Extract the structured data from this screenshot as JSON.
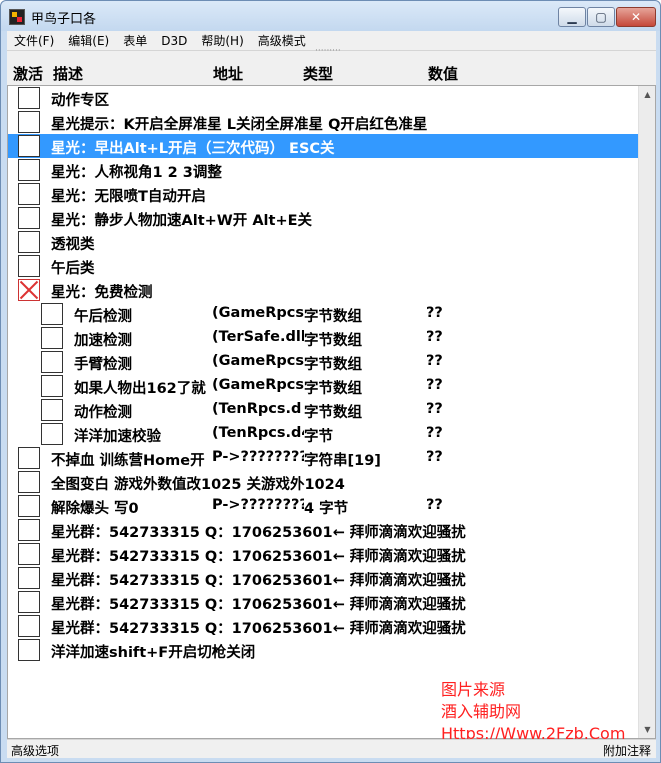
{
  "window": {
    "title": "甲鸟子口各",
    "controls": {
      "minimize": "▁",
      "maximize": "▢",
      "close": "✕"
    }
  },
  "menu": [
    "文件(F)",
    "编辑(E)",
    "表单",
    "D3D",
    "帮助(H)",
    "高级模式"
  ],
  "columns": {
    "activate": "激活",
    "description": "描述",
    "address": "地址",
    "type": "类型",
    "value": "数值"
  },
  "rows": [
    {
      "desc": "动作专区",
      "addr": "",
      "type": "",
      "value": "",
      "checked": false,
      "indent": 0
    },
    {
      "desc": "星光提示：K开启全屏准星 L关闭全屏准星 Q开启红色准星",
      "addr": "",
      "type": "",
      "value": "",
      "checked": false,
      "indent": 0
    },
    {
      "desc": "星光：早出Alt+L开启（三次代码） ESC关",
      "addr": "",
      "type": "",
      "value": "",
      "checked": false,
      "indent": 0,
      "selected": true
    },
    {
      "desc": "星光：人称视角1 2 3调整",
      "addr": "",
      "type": "",
      "value": "",
      "checked": false,
      "indent": 0
    },
    {
      "desc": "星光：无限喷T自动开启",
      "addr": "",
      "type": "",
      "value": "",
      "checked": false,
      "indent": 0
    },
    {
      "desc": "星光：静步人物加速Alt+W开 Alt+E关",
      "addr": "",
      "type": "",
      "value": "",
      "checked": false,
      "indent": 0
    },
    {
      "desc": "透视类",
      "addr": "",
      "type": "",
      "value": "",
      "checked": false,
      "indent": 0
    },
    {
      "desc": "午后类",
      "addr": "",
      "type": "",
      "value": "",
      "checked": false,
      "indent": 0
    },
    {
      "desc": "星光：免费检测",
      "addr": "",
      "type": "",
      "value": "",
      "checked": true,
      "indent": 0
    },
    {
      "desc": "午后检测",
      "addr": "(GameRpcs",
      "type": "字节数组",
      "value": "??",
      "checked": false,
      "indent": 1
    },
    {
      "desc": "加速检测",
      "addr": "(TerSafe.dll",
      "type": "字节数组",
      "value": "??",
      "checked": false,
      "indent": 1
    },
    {
      "desc": "手臂检测",
      "addr": "(GameRpcs",
      "type": "字节数组",
      "value": "??",
      "checked": false,
      "indent": 1
    },
    {
      "desc": "如果人物出162了就",
      "addr": "(GameRpcs",
      "type": "字节数组",
      "value": "??",
      "checked": false,
      "indent": 1
    },
    {
      "desc": "动作检测",
      "addr": "(TenRpcs.d",
      "type": "字节数组",
      "value": "??",
      "checked": false,
      "indent": 1
    },
    {
      "desc": "洋洋加速校验",
      "addr": "(TenRpcs.d4",
      "type": "字节",
      "value": "??",
      "checked": false,
      "indent": 1
    },
    {
      "desc": "不掉血 训练营Home开",
      "addr": "P->????????",
      "type": "字符串[19]",
      "value": "??",
      "checked": false,
      "indent": 0
    },
    {
      "desc": "全图变白 游戏外数值改1025 关游戏外1024",
      "addr": "",
      "type": "",
      "value": "",
      "checked": false,
      "indent": 0
    },
    {
      "desc": "解除爆头 写0",
      "addr": "P->????????",
      "type": "4 字节",
      "value": "??",
      "checked": false,
      "indent": 0
    },
    {
      "desc": "星光群：542733315  Q：1706253601← 拜师滴滴欢迎骚扰",
      "addr": "",
      "type": "",
      "value": "",
      "checked": false,
      "indent": 0
    },
    {
      "desc": "星光群：542733315  Q：1706253601← 拜师滴滴欢迎骚扰",
      "addr": "",
      "type": "",
      "value": "",
      "checked": false,
      "indent": 0
    },
    {
      "desc": "星光群：542733315  Q：1706253601← 拜师滴滴欢迎骚扰",
      "addr": "",
      "type": "",
      "value": "",
      "checked": false,
      "indent": 0
    },
    {
      "desc": "星光群：542733315  Q：1706253601← 拜师滴滴欢迎骚扰",
      "addr": "",
      "type": "",
      "value": "",
      "checked": false,
      "indent": 0
    },
    {
      "desc": "星光群：542733315  Q：1706253601← 拜师滴滴欢迎骚扰",
      "addr": "",
      "type": "",
      "value": "",
      "checked": false,
      "indent": 0
    },
    {
      "desc": "洋洋加速shift+F开启切枪关闭",
      "addr": "",
      "type": "",
      "value": "",
      "checked": false,
      "indent": 0
    }
  ],
  "scrollbar": {
    "up": "▲",
    "down": "▼"
  },
  "watermark": [
    "图片来源",
    "酒入辅助网",
    "Https://Www.2Fzb.Com"
  ],
  "status": {
    "left": "高级选项",
    "right": "附加注释"
  },
  "colors": {
    "selection": "#3399ff",
    "watermark": "#ff2020",
    "checked_mark": "#dd3333"
  }
}
